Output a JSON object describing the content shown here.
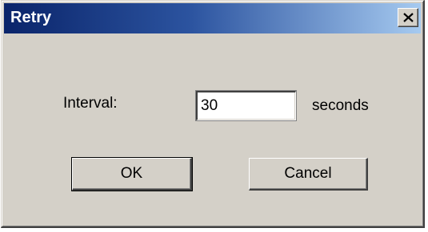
{
  "window": {
    "title": "Retry",
    "close_icon": "close-x-icon"
  },
  "form": {
    "interval_label": "Interval:",
    "interval_value": "30",
    "unit_label": "seconds"
  },
  "buttons": {
    "ok_label": "OK",
    "cancel_label": "Cancel"
  },
  "colors": {
    "title_gradient_start": "#0a246a",
    "title_gradient_end": "#a6caf0",
    "dialog_background": "#d4d0c8"
  }
}
